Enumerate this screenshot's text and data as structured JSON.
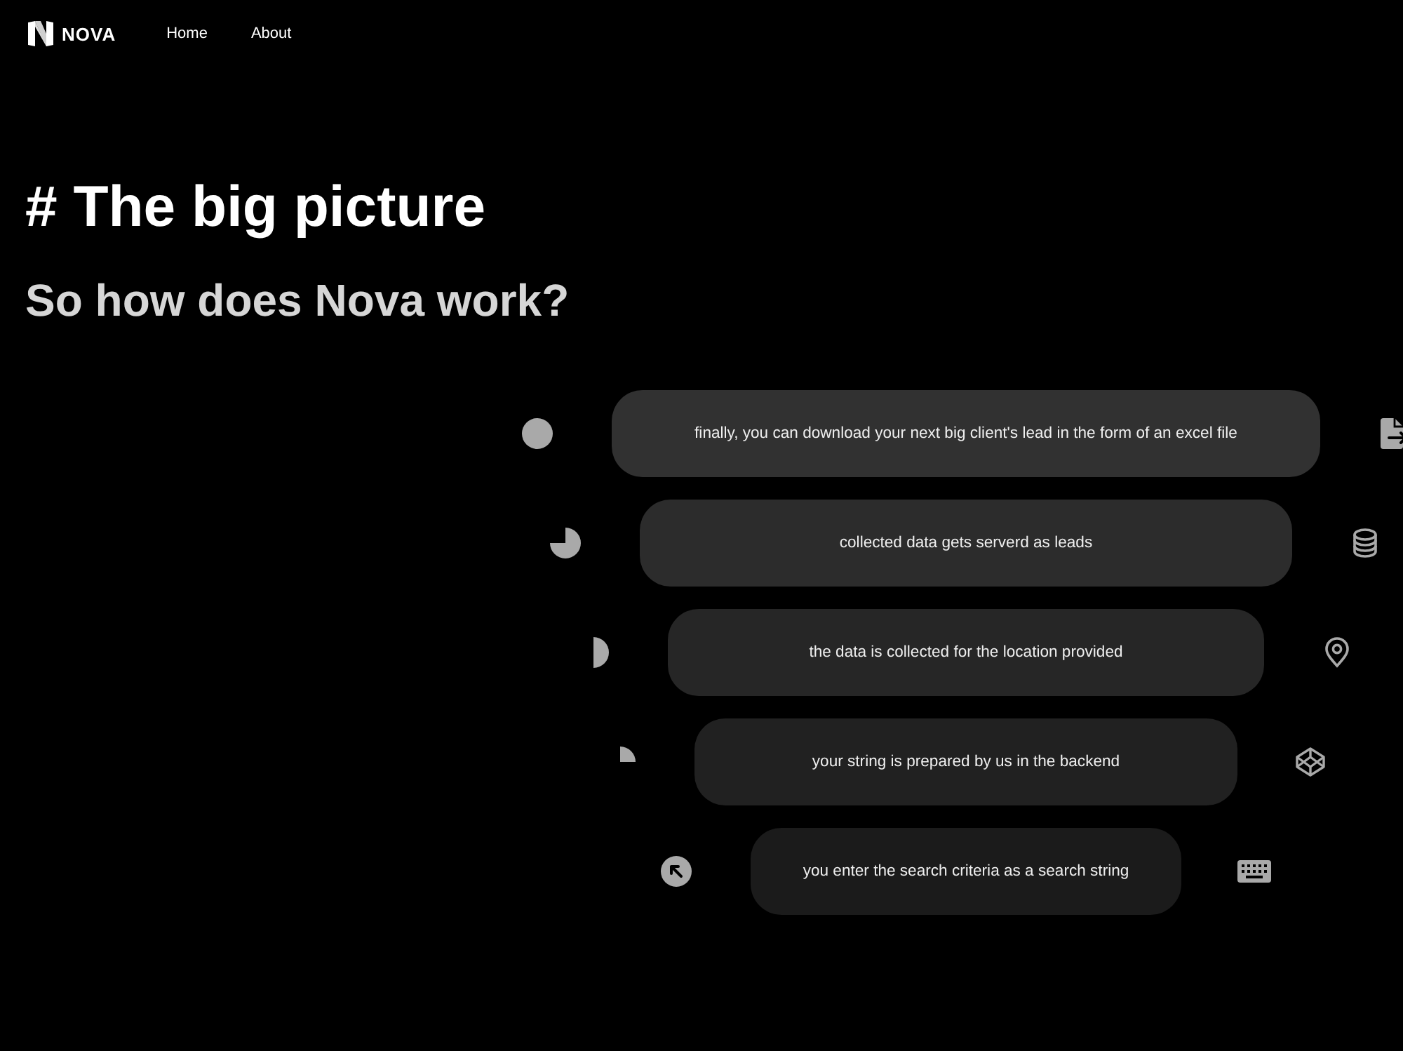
{
  "header": {
    "brand": "NOVA",
    "nav": [
      {
        "label": "Home"
      },
      {
        "label": "About"
      }
    ]
  },
  "hero": {
    "title": "# The big picture",
    "subtitle": "So how does Nova work?"
  },
  "steps": [
    {
      "text": "finally, you can download your next big client's lead in the form of an excel file",
      "marker": {
        "kind": "full"
      }
    },
    {
      "text": "collected data gets serverd as leads",
      "marker": {
        "kind": "threequarter"
      }
    },
    {
      "text": "the data is collected for the location provided",
      "marker": {
        "kind": "half"
      }
    },
    {
      "text": "your string is prepared by us in the backend",
      "marker": {
        "kind": "quarter"
      }
    },
    {
      "text": "you enter the search criteria as a search string",
      "marker": {
        "kind": "arrow"
      }
    }
  ]
}
